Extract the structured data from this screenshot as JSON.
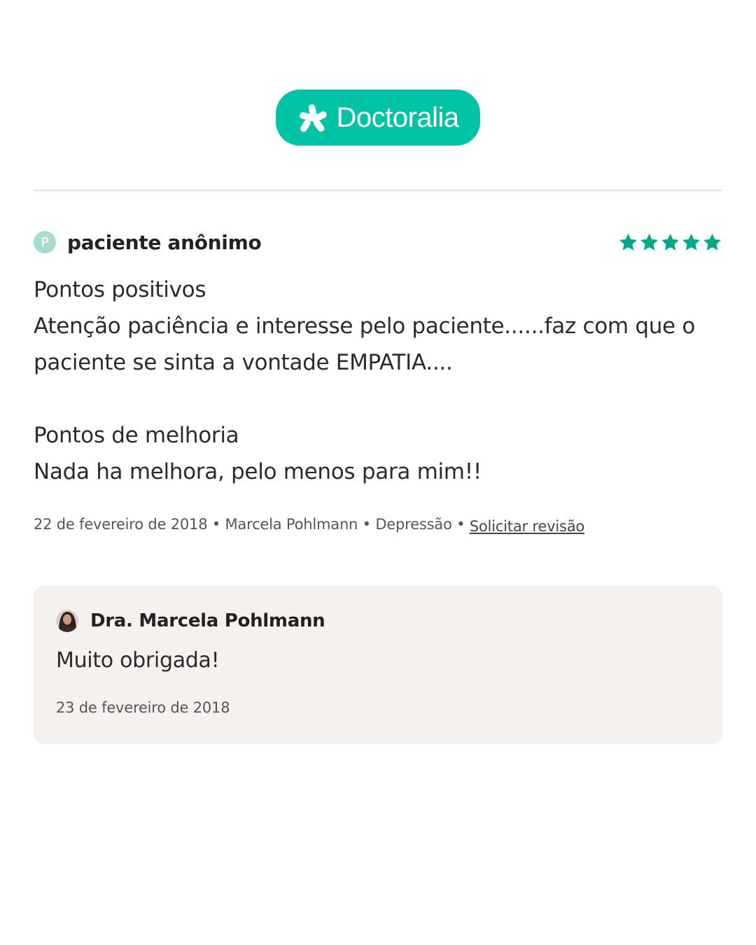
{
  "brand": {
    "name": "Doctoralia",
    "logo_icon": "doctoralia-star-icon",
    "accent_color": "#00c3a5"
  },
  "review": {
    "author_initial": "P",
    "author_name": "paciente anônimo",
    "rating": 5,
    "rating_max": 5,
    "star_color": "#00a887",
    "positives_heading": "Pontos positivos",
    "positives_text": "Atenção paciência e interesse pelo paciente......faz com que o paciente se sinta a vontade EMPATIA....",
    "improvements_heading": "Pontos de melhoria",
    "improvements_text": "Nada ha melhora, pelo menos para mim!!",
    "date": "22 de fevereiro de 2018",
    "doctor": "Marcela Pohlmann",
    "condition": "Depressão",
    "separator": " • ",
    "request_review_label": "Solicitar revisão"
  },
  "reply": {
    "author_name": "Dra. Marcela Pohlmann",
    "avatar_icon": "doctor-avatar-photo",
    "text": "Muito obrigada!",
    "date": "23 de fevereiro de 2018"
  }
}
